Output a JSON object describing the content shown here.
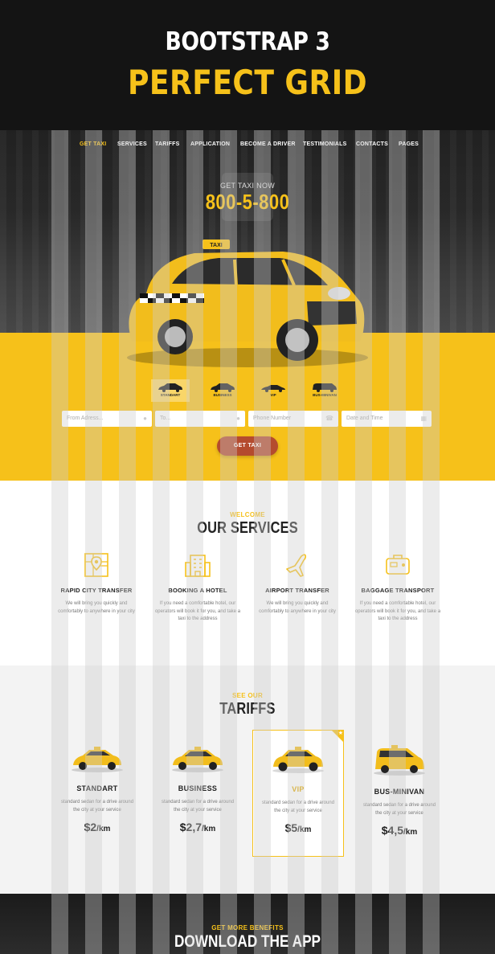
{
  "banner": {
    "title": "BOOTSTRAP 3",
    "subtitle": "PERFECT GRID"
  },
  "nav": {
    "items": [
      "GET TAXI",
      "SERVICES",
      "TARIFFS",
      "APPLICATION",
      "BECOME A DRIVER",
      "TESTIMONIALS",
      "CONTACTS",
      "PAGES"
    ],
    "active_index": 0
  },
  "hero": {
    "call_label": "GET TAXI NOW",
    "phone": "800-5-800"
  },
  "car_types": [
    "STANDART",
    "BUSINESS",
    "VIP",
    "BUS-MINIVAN"
  ],
  "form": {
    "from": "From Adress...",
    "to": "To...",
    "phone": "Phone Number",
    "datetime": "Date and Time",
    "submit": "GET TAXI"
  },
  "services": {
    "eyebrow": "WELCOME",
    "title": "OUR SERVICES",
    "items": [
      {
        "title": "RAPID CITY TRANSFER",
        "text": "We will bring you quickly and comfortably to anywhere in your city",
        "icon": "map-icon"
      },
      {
        "title": "BOOKING A HOTEL",
        "text": "If you need a comfortable hotel, our operators will book it for you, and take a taxi to the address",
        "icon": "hotel-icon"
      },
      {
        "title": "AIRPORT TRANSFER",
        "text": "We will bring you quickly and comfortably to anywhere in your city",
        "icon": "airplane-icon"
      },
      {
        "title": "BAGGAGE TRANSPORT",
        "text": "If you need a comfortable hotel, our operators will book it for you, and take a taxi to the address",
        "icon": "suitcase-icon"
      }
    ]
  },
  "tariffs": {
    "eyebrow": "SEE OUR",
    "title": "TARIFFS",
    "items": [
      {
        "name": "STANDART",
        "desc": "standard sedan for a drive around the city at your service",
        "price": "$2",
        "unit": "/km"
      },
      {
        "name": "BUSINESS",
        "desc": "standard sedan for a drive around the city at your service",
        "price": "$2,7",
        "unit": "/km"
      },
      {
        "name": "VIP",
        "desc": "standard sedan for a drive around the city at your service",
        "price": "$5",
        "unit": "/km"
      },
      {
        "name": "BUS-MINIVAN",
        "desc": "standard sedan for a drive around the city at your service",
        "price": "$4,5",
        "unit": "/km"
      }
    ],
    "featured_index": 2
  },
  "app": {
    "eyebrow": "GET MORE BENEFITS",
    "title": "DOWNLOAD THE APP"
  },
  "colors": {
    "accent": "#f6c11a",
    "dark": "#141414",
    "button": "#b44b2e"
  }
}
